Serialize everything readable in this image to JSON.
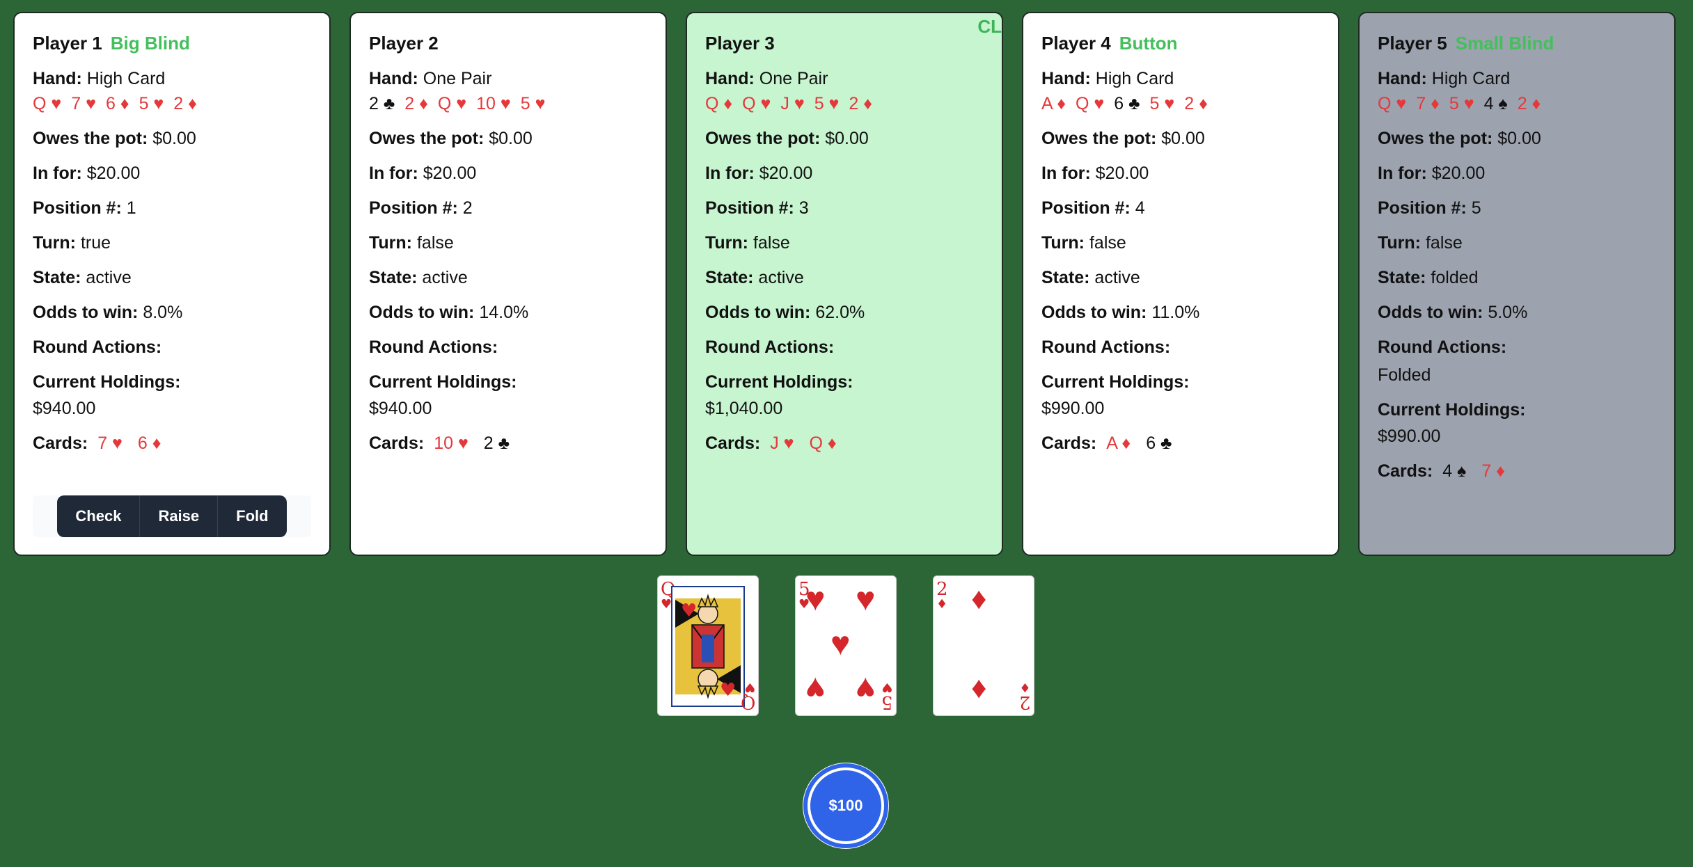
{
  "labels": {
    "hand": "Hand:",
    "owes": "Owes the pot:",
    "in_for": "In for:",
    "position": "Position #:",
    "turn": "Turn:",
    "state": "State:",
    "odds": "Odds to win:",
    "round_actions": "Round Actions:",
    "holdings": "Current Holdings:",
    "cards": "Cards:"
  },
  "players": [
    {
      "name": "Player 1",
      "role": "Big Blind",
      "hand": "High Card",
      "hand_cards": [
        {
          "t": "Q ♥",
          "c": "red"
        },
        {
          "t": "7 ♥",
          "c": "red"
        },
        {
          "t": "6 ♦",
          "c": "red"
        },
        {
          "t": "5 ♥",
          "c": "red"
        },
        {
          "t": "2 ♦",
          "c": "red"
        }
      ],
      "owes": "$0.00",
      "in_for": "$20.00",
      "position": "1",
      "turn": "true",
      "state": "active",
      "odds": "8.0%",
      "round_actions": "",
      "holdings": "$940.00",
      "cards": [
        {
          "t": "7 ♥",
          "c": "red"
        },
        {
          "t": "6 ♦",
          "c": "red"
        }
      ]
    },
    {
      "name": "Player 2",
      "role": "",
      "hand": "One Pair",
      "hand_cards": [
        {
          "t": "2 ♣",
          "c": "black"
        },
        {
          "t": "2 ♦",
          "c": "red"
        },
        {
          "t": "Q ♥",
          "c": "red"
        },
        {
          "t": "10 ♥",
          "c": "red"
        },
        {
          "t": "5 ♥",
          "c": "red"
        }
      ],
      "owes": "$0.00",
      "in_for": "$20.00",
      "position": "2",
      "turn": "false",
      "state": "active",
      "odds": "14.0%",
      "round_actions": "",
      "holdings": "$940.00",
      "cards": [
        {
          "t": "10 ♥",
          "c": "red"
        },
        {
          "t": "2 ♣",
          "c": "black"
        }
      ]
    },
    {
      "name": "Player 3",
      "role": "",
      "tag": "CL",
      "hand": "One Pair",
      "hand_cards": [
        {
          "t": "Q ♦",
          "c": "red"
        },
        {
          "t": "Q ♥",
          "c": "red"
        },
        {
          "t": "J ♥",
          "c": "red"
        },
        {
          "t": "5 ♥",
          "c": "red"
        },
        {
          "t": "2 ♦",
          "c": "red"
        }
      ],
      "owes": "$0.00",
      "in_for": "$20.00",
      "position": "3",
      "turn": "false",
      "state": "active",
      "odds": "62.0%",
      "round_actions": "",
      "holdings": "$1,040.00",
      "cards": [
        {
          "t": "J ♥",
          "c": "red"
        },
        {
          "t": "Q ♦",
          "c": "red"
        }
      ]
    },
    {
      "name": "Player 4",
      "role": "Button",
      "hand": "High Card",
      "hand_cards": [
        {
          "t": "A ♦",
          "c": "red"
        },
        {
          "t": "Q ♥",
          "c": "red"
        },
        {
          "t": "6 ♣",
          "c": "black"
        },
        {
          "t": "5 ♥",
          "c": "red"
        },
        {
          "t": "2 ♦",
          "c": "red"
        }
      ],
      "owes": "$0.00",
      "in_for": "$20.00",
      "position": "4",
      "turn": "false",
      "state": "active",
      "odds": "11.0%",
      "round_actions": "",
      "holdings": "$990.00",
      "cards": [
        {
          "t": "A ♦",
          "c": "red"
        },
        {
          "t": "6 ♣",
          "c": "black"
        }
      ]
    },
    {
      "name": "Player 5",
      "role": "Small Blind",
      "hand": "High Card",
      "hand_cards": [
        {
          "t": "Q ♥",
          "c": "red"
        },
        {
          "t": "7 ♦",
          "c": "red"
        },
        {
          "t": "5 ♥",
          "c": "red"
        },
        {
          "t": "4 ♠",
          "c": "black"
        },
        {
          "t": "2 ♦",
          "c": "red"
        }
      ],
      "owes": "$0.00",
      "in_for": "$20.00",
      "position": "5",
      "turn": "false",
      "state": "folded",
      "odds": "5.0%",
      "round_actions": "Folded",
      "holdings": "$990.00",
      "cards": [
        {
          "t": "4 ♠",
          "c": "black"
        },
        {
          "t": "7 ♦",
          "c": "red"
        }
      ]
    }
  ],
  "actions": {
    "check": "Check",
    "raise": "Raise",
    "fold": "Fold"
  },
  "board": [
    {
      "rank": "Q",
      "suit": "♥"
    },
    {
      "rank": "5",
      "suit": "♥"
    },
    {
      "rank": "2",
      "suit": "♦"
    }
  ],
  "pot": "$100",
  "colors": {
    "table": "#2c6637",
    "role": "#44bf5c",
    "red_suit": "#e5383b",
    "winner_bg": "#c7f5d0",
    "folded_bg": "#9ca2ae",
    "chip": "#2f63e8"
  }
}
